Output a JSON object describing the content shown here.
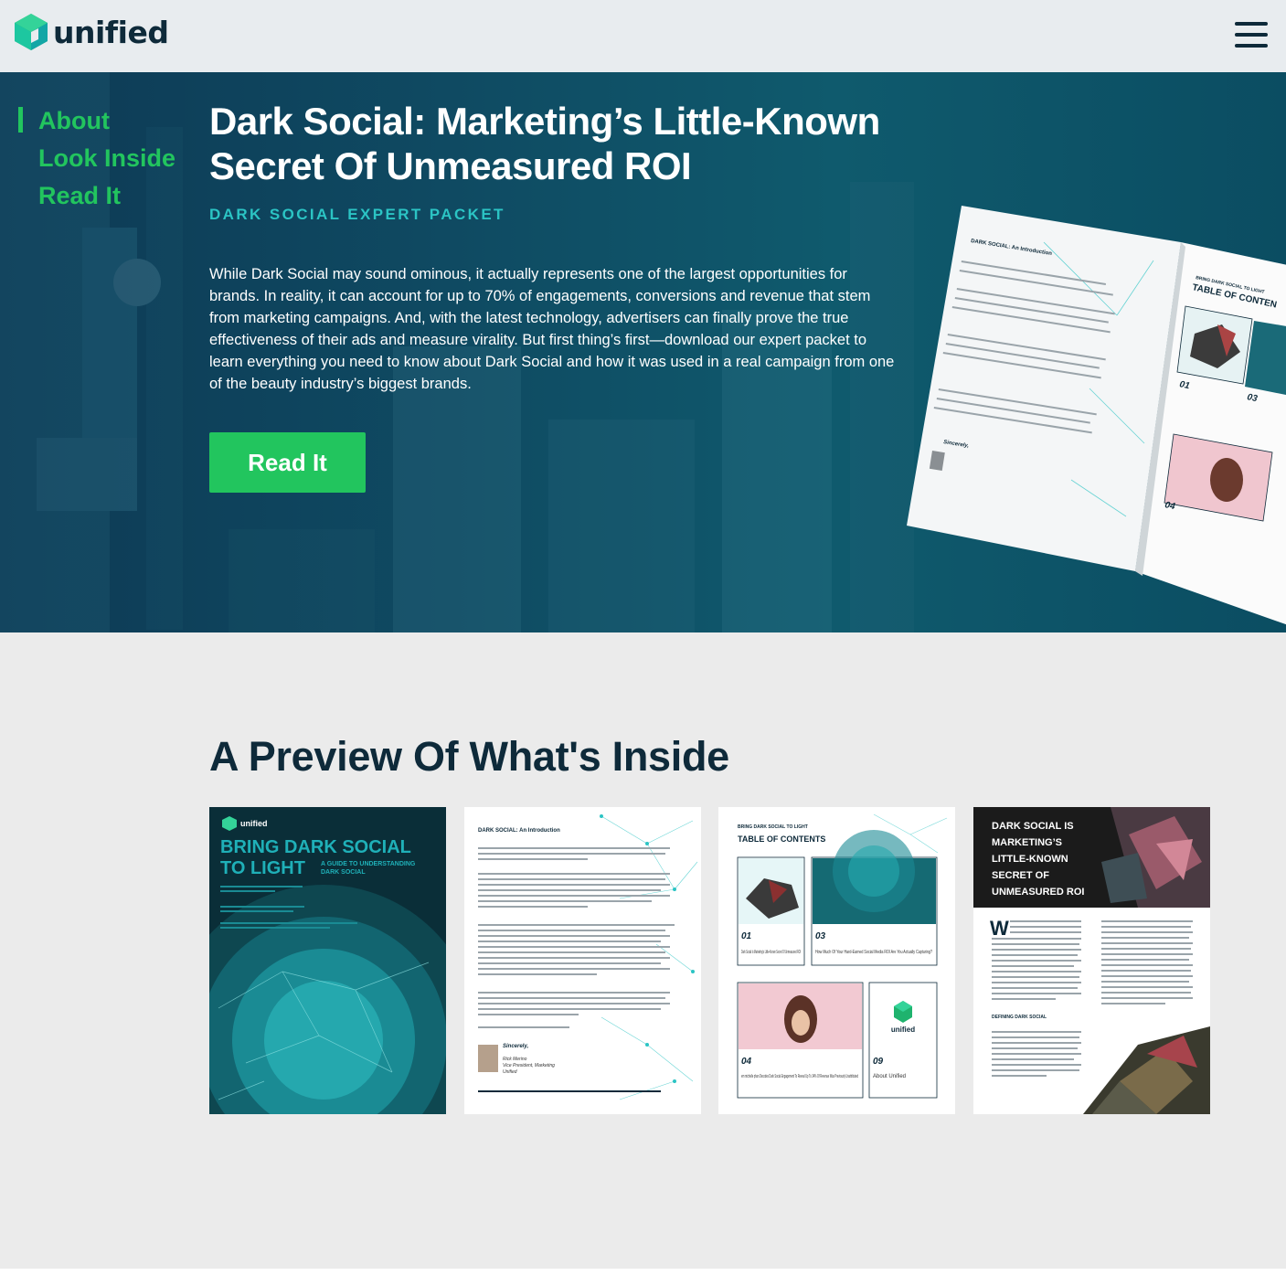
{
  "header": {
    "brand": "unified",
    "menu_icon": "hamburger-menu-icon"
  },
  "side_nav": {
    "items": [
      {
        "label": "About",
        "active": true
      },
      {
        "label": "Look Inside",
        "active": false
      },
      {
        "label": "Read It",
        "active": false
      }
    ]
  },
  "hero": {
    "title": "Dark Social: Marketing’s Little-Known Secret Of Unmeasured ROI",
    "subtitle": "DARK SOCIAL EXPERT PACKET",
    "body": "While Dark Social may sound ominous, it actually represents one of the largest opportunities for brands. In reality, it can account for up to 70% of engagements, conversions and revenue that stem from marketing campaigns. And, with the latest technology, advertisers can finally prove the true effectiveness of their ads and measure virality. But first thing’s first—download our expert packet to learn everything you need to know about Dark Social and how it was used in a real campaign from one of the beauty industry’s biggest brands.",
    "cta_label": "Read It"
  },
  "magazine": {
    "left_heading": "DARK SOCIAL: An Introduction",
    "right_kicker": "BRING DARK SOCIAL TO LIGHT",
    "right_heading": "TABLE OF CONTEN",
    "num_01": "01",
    "num_03": "03",
    "num_04": "04",
    "signoff": "Sincerely,"
  },
  "preview": {
    "title": "A Preview Of What's Inside",
    "thumb1": {
      "brand": "unified",
      "title_line1": "BRING DARK SOCIAL",
      "title_line2": "TO LIGHT",
      "tagline_line1": "A GUIDE TO UNDERSTANDING",
      "tagline_line2": "DARK SOCIAL"
    },
    "thumb2": {
      "heading": "DARK SOCIAL: An Introduction",
      "signoff": "Sincerely,",
      "signer_name": "Rick Merino",
      "signer_title": "Vice President, Marketing",
      "signer_org": "Unified"
    },
    "thumb3": {
      "kicker": "BRING DARK SOCIAL TO LIGHT",
      "heading": "TABLE OF CONTENTS",
      "items": [
        {
          "num": "01",
          "text": "Dark Social Is Marketing's Little-Known Secret Of Unmeasured ROI"
        },
        {
          "num": "03",
          "text": "How Much Of Your Hard-Earned Social Media ROI Are You Actually Capturing?"
        },
        {
          "num": "04",
          "text": "em michelle phan Decodes Dark Social Engagement To Reveal Up To 34% Of Revenue Was Previously Unattributed"
        },
        {
          "num": "09",
          "text": "About Unified"
        }
      ],
      "logo_text": "unified"
    },
    "thumb4": {
      "heading_lines": [
        "DARK SOCIAL IS",
        "MARKETING’S",
        "LITTLE-KNOWN",
        "SECRET OF",
        "UNMEASURED ROI"
      ],
      "section_heading": "DEFINING DARK SOCIAL",
      "dropcap": "W"
    }
  },
  "colors": {
    "accent_green": "#22c55e",
    "teal": "#2bc4c4",
    "navy": "#0e2a3a"
  }
}
